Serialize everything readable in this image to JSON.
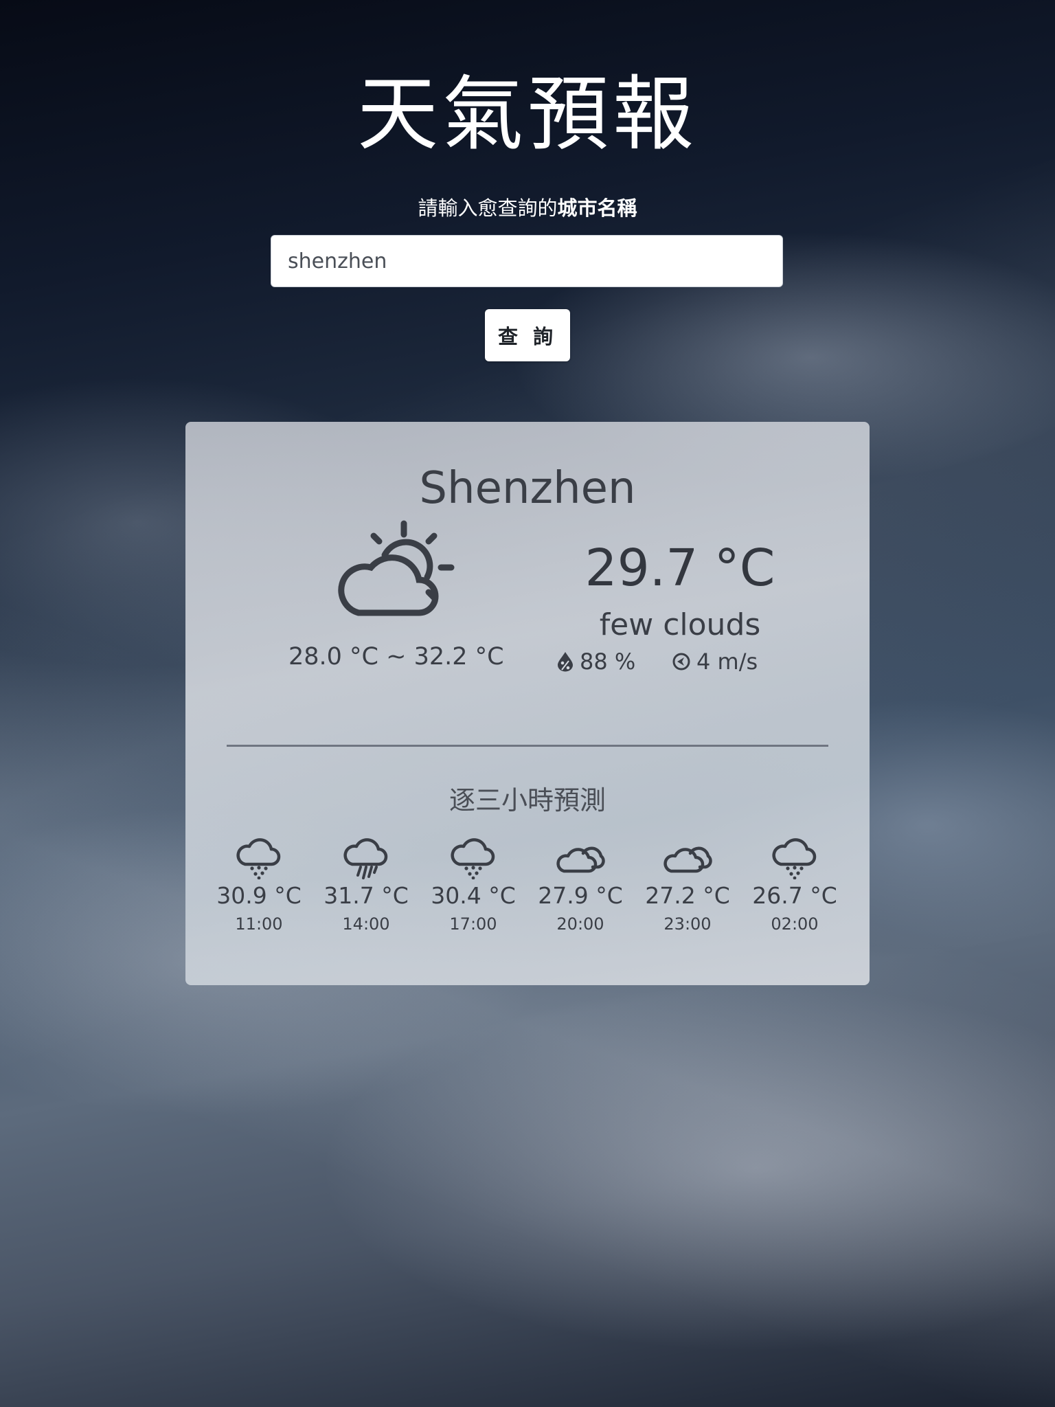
{
  "header": {
    "title": "天氣預報",
    "prompt_prefix": "請輸入愈查詢的",
    "prompt_bold": "城市名稱"
  },
  "search": {
    "value": "shenzhen",
    "button_label": "查 詢"
  },
  "current": {
    "city": "Shenzhen",
    "icon": "partly-cloudy-day-icon",
    "temp_range": "28.0 °C ~ 32.2 °C",
    "temperature": "29.7 °C",
    "condition": "few clouds",
    "humidity": "88 %",
    "humidity_icon": "humidity-drop-icon",
    "wind": "4 m/s",
    "wind_icon": "wind-direction-icon"
  },
  "forecast": {
    "title": "逐三小時預測",
    "items": [
      {
        "icon": "rain-showers-icon",
        "temp": "30.9 °C",
        "time": "11:00"
      },
      {
        "icon": "heavy-rain-icon",
        "temp": "31.7 °C",
        "time": "14:00"
      },
      {
        "icon": "rain-showers-icon",
        "temp": "30.4 °C",
        "time": "17:00"
      },
      {
        "icon": "cloudy-icon",
        "temp": "27.9 °C",
        "time": "20:00"
      },
      {
        "icon": "cloudy-icon",
        "temp": "27.2 °C",
        "time": "23:00"
      },
      {
        "icon": "rain-showers-icon",
        "temp": "26.7 °C",
        "time": "02:00"
      }
    ]
  },
  "colors": {
    "card_text": "#33373f",
    "divider": "#6f7581",
    "title_text": "#ffffff"
  }
}
